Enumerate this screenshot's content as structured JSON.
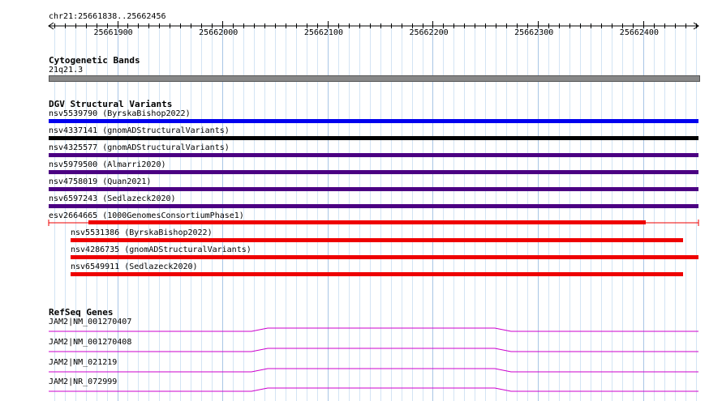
{
  "ruler": {
    "location": "chr21:25661838..25662456",
    "ticks": [
      {
        "value": 25661900,
        "label": "25661900"
      },
      {
        "value": 25662000,
        "label": "25662000"
      },
      {
        "value": 25662100,
        "label": "25662100"
      },
      {
        "value": 25662200,
        "label": "25662200"
      },
      {
        "value": 25662300,
        "label": "25662300"
      },
      {
        "value": 25662400,
        "label": "25662400"
      }
    ]
  },
  "cytoband": {
    "title": "Cytogenetic Bands",
    "band_label": "21q21.3",
    "color": "#888888"
  },
  "dgv": {
    "title": "DGV Structural Variants",
    "features": [
      {
        "label": "nsv5539790 (ByrskaBishop2022)",
        "color": "#0000ee"
      },
      {
        "label": "nsv4337141 (gnomADStructuralVariants)",
        "color": "#000000"
      },
      {
        "label": "nsv4325577 (gnomADStructuralVariants)",
        "color": "#4b0082"
      },
      {
        "label": "nsv5979500 (Almarri2020)",
        "color": "#4b0082"
      },
      {
        "label": "nsv4758019 (Quan2021)",
        "color": "#4b0082"
      },
      {
        "label": "nsv6597243 (Sedlazeck2020)",
        "color": "#4b0082"
      },
      {
        "label": "esv2664665 (1000GenomesConsortiumPhase1)",
        "color": "#ee0000"
      },
      {
        "label": "nsv5531386 (ByrskaBishop2022)",
        "color": "#ee0000"
      },
      {
        "label": "nsv4286735 (gnomADStructuralVariants)",
        "color": "#ee0000"
      },
      {
        "label": "nsv6549911 (Sedlazeck2020)",
        "color": "#ee0000"
      }
    ]
  },
  "refseq": {
    "title": "RefSeq Genes",
    "color": "#cc00cc",
    "genes": [
      {
        "label": "JAM2|NM_001270407"
      },
      {
        "label": "JAM2|NM_001270408"
      },
      {
        "label": "JAM2|NM_021219"
      },
      {
        "label": "JAM2|NR_072999"
      }
    ]
  }
}
